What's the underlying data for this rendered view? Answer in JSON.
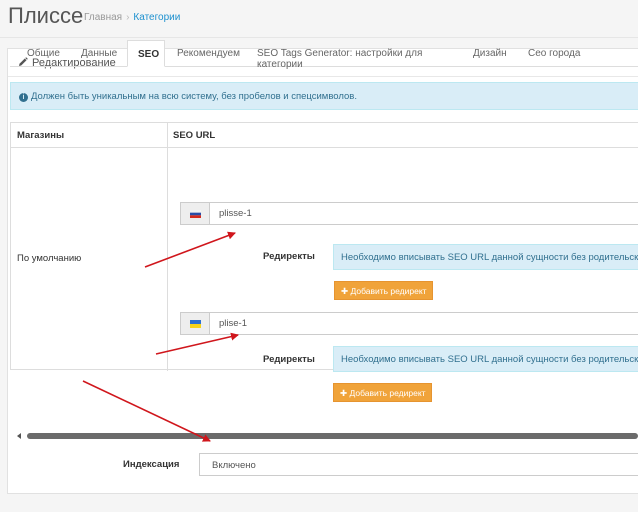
{
  "header": {
    "title": "Плиссе",
    "breadcrumb": [
      "Главная",
      "Категории"
    ],
    "separator": "›"
  },
  "panel": {
    "heading": "Редактирование"
  },
  "tabs": [
    {
      "label": "Общие",
      "active": false
    },
    {
      "label": "Данные",
      "active": false
    },
    {
      "label": "SEO",
      "active": true
    },
    {
      "label": "Рекомендуем",
      "active": false
    },
    {
      "label": "SEO Tags Generator: настройки для категории",
      "active": false
    },
    {
      "label": "Дизайн",
      "active": false
    },
    {
      "label": "Сео города",
      "active": false
    }
  ],
  "alert": {
    "text": "Должен быть уникальным на всю систему, без пробелов и спецсимволов."
  },
  "table": {
    "headers": {
      "stores": "Магазины",
      "seo_url": "SEO URL"
    },
    "store": "По умолчанию",
    "languages": [
      {
        "flag": "russia-flag-icon",
        "value": "plisse-1",
        "redirects_label": "Редиректы",
        "redirects_note": "Необходимо вписывать SEO URL данной сущности без родительской",
        "add_button": "Добавить редирект"
      },
      {
        "flag": "ukraine-flag-icon",
        "value": "plise-1",
        "redirects_label": "Редиректы",
        "redirects_note": "Необходимо вписывать SEO URL данной сущности без родительской",
        "add_button": "Добавить редирект"
      }
    ]
  },
  "indexing": {
    "label": "Индексация",
    "value": "Включено"
  },
  "colors": {
    "accent": "#1e91cf",
    "warning_button": "#f0a33a",
    "info_bg": "#d9edf7",
    "annotation_arrow": "#d0161c"
  }
}
